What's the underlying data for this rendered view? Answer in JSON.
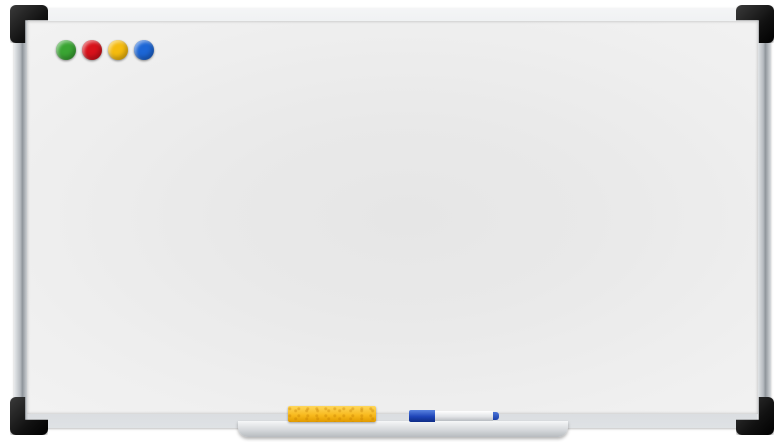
{
  "whiteboard": {
    "magnets": [
      {
        "name": "green-magnet",
        "color": "#3aa533"
      },
      {
        "name": "red-magnet",
        "color": "#d8121b"
      },
      {
        "name": "yellow-magnet",
        "color": "#f5bb0e"
      },
      {
        "name": "blue-magnet",
        "color": "#1c66d6"
      }
    ],
    "surface_color": "#ebebeb",
    "frame_color": "#c3c7cb",
    "corner_color": "#111111",
    "eraser_color": "#f7b81b",
    "marker_color": "#1e45b8"
  }
}
